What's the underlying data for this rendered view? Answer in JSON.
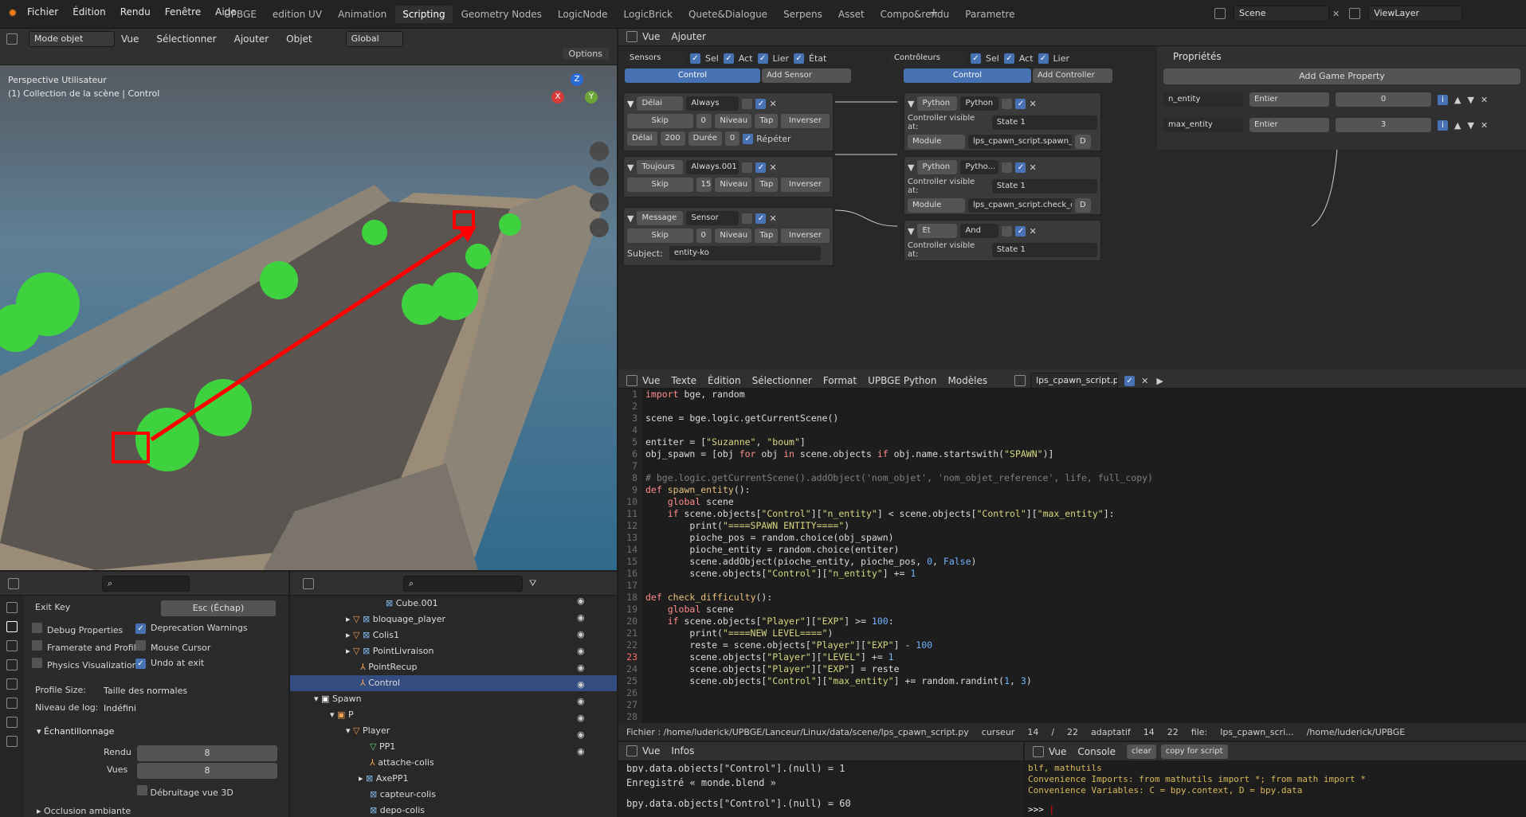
{
  "menu": [
    "Fichier",
    "Édition",
    "Rendu",
    "Fenêtre",
    "Aide"
  ],
  "workspaces": [
    "UPBGE",
    "edition UV",
    "Animation",
    "Scripting",
    "Geometry Nodes",
    "LogicNode",
    "LogicBrick",
    "Quete&Dialogue",
    "Serpens",
    "Asset",
    "Compo&rendu",
    "Parametre"
  ],
  "active_workspace": "Scripting",
  "scene": {
    "name": "Scene",
    "view_layer": "ViewLayer"
  },
  "viewport": {
    "mode": "Mode objet",
    "menus": [
      "Vue",
      "Sélectionner",
      "Ajouter",
      "Objet"
    ],
    "transform": "Global",
    "options": "Options",
    "overlay_title": "Perspective Utilisateur",
    "overlay_sub": "(1) Collection de la scène | Control",
    "gizmo": {
      "x": "X",
      "y": "Y",
      "z": "Z"
    }
  },
  "logic": {
    "menus": [
      "Vue",
      "Ajouter"
    ],
    "sensors_header": {
      "title": "Sensors",
      "sel": "Sel",
      "act": "Act",
      "lier": "Lier",
      "etat": "État",
      "control": "Control",
      "add": "Add Sensor"
    },
    "controllers_header": {
      "title": "Contrôleurs",
      "sel": "Sel",
      "act": "Act",
      "lier": "Lier",
      "control": "Control",
      "add": "Add Controller"
    },
    "sensors": [
      {
        "type": "Délai",
        "name": "Always",
        "skip_label": "Skip",
        "skip": "0",
        "niveau": "Niveau",
        "tap": "Tap",
        "inverser": "Inverser",
        "extra": {
          "delai_label": "Délai",
          "delai": "200",
          "duree_label": "Durée",
          "duree": "0",
          "repeter": "Répéter"
        }
      },
      {
        "type": "Toujours",
        "name": "Always.001",
        "skip_label": "Skip",
        "skip": "15",
        "niveau": "Niveau",
        "tap": "Tap",
        "inverser": "Inverser"
      },
      {
        "type": "Message",
        "name": "Sensor",
        "skip_label": "Skip",
        "skip": "0",
        "niveau": "Niveau",
        "tap": "Tap",
        "inverser": "Inverser",
        "subject_label": "Subject:",
        "subject": "entity-ko"
      }
    ],
    "controllers": [
      {
        "type": "Python",
        "name": "Python",
        "visible_label": "Controller visible at:",
        "state": "State 1",
        "mode": "Module",
        "script": "lps_cpawn_script.spawn_...",
        "d": "D"
      },
      {
        "type": "Python",
        "name": "Pytho...",
        "visible_label": "Controller visible at:",
        "state": "State 1",
        "mode": "Module",
        "script": "lps_cpawn_script.check_d...",
        "d": "D"
      },
      {
        "type": "Et",
        "name": "And",
        "visible_label": "Controller visible at:",
        "state": "State 1"
      }
    ]
  },
  "properties": {
    "title": "Propriétés",
    "add": "Add Game Property",
    "items": [
      {
        "name": "n_entity",
        "type": "Entier",
        "value": "0"
      },
      {
        "name": "max_entity",
        "type": "Entier",
        "value": "3"
      }
    ]
  },
  "text_editor": {
    "menus": [
      "Vue",
      "Texte",
      "Édition",
      "Sélectionner",
      "Format",
      "UPBGE Python",
      "Modèles"
    ],
    "filename": "lps_cpawn_script.py",
    "line_numbers": [
      "1",
      "2",
      "3",
      "4",
      "5",
      "6",
      "7",
      "8",
      "9",
      "10",
      "11",
      "12",
      "13",
      "14",
      "15",
      "16",
      "17",
      "18",
      "19",
      "20",
      "21",
      "22",
      "23",
      "24",
      "25",
      "26",
      "27",
      "28"
    ],
    "status": {
      "file": "Fichier : /home/luderick/UPBGE/Lanceur/Linux/data/scene/lps_cpawn_script.py",
      "cursor": "curseur",
      "c1": "14",
      "slash": "/",
      "c2": "22",
      "mode": "adaptatif",
      "c3": "14",
      "c4": "22",
      "file2": "file:",
      "file2name": "lps_cpawn_scri...",
      "path2": "/home/luderick/UPBGE"
    }
  },
  "info_log": {
    "menus": [
      "Vue",
      "Infos"
    ],
    "lines": [
      "bpy.data.objects[\"Control\"].(null) = 1",
      "Enregistré « monde.blend »",
      "bpy.data.objects[\"Control\"].(null) = 60"
    ]
  },
  "console": {
    "menus": [
      "Vue",
      "Console"
    ],
    "clear": "clear",
    "copy": "copy for script",
    "lines": [
      "blf, mathutils",
      "Convenience Imports:   from mathutils import *; from math import *",
      "Convenience Variables: C = bpy.context, D = bpy.data"
    ],
    "prompt": ">>> "
  },
  "render_props": {
    "exit_key_label": "Exit Key",
    "exit_key": "Esc (Échap)",
    "checks": [
      {
        "label": "Debug Properties",
        "on": false
      },
      {
        "label": "Deprecation Warnings",
        "on": true
      },
      {
        "label": "Framerate and Profile",
        "on": false
      },
      {
        "label": "Mouse Cursor",
        "on": false
      },
      {
        "label": "Physics Visualization",
        "on": false
      },
      {
        "label": "Undo at exit",
        "on": true
      }
    ],
    "profile_label": "Profile Size:",
    "profile": "Taille des normales",
    "log_label": "Niveau de log:",
    "log": "Indéfini",
    "sampling": "Échantillonnage",
    "rendu_label": "Rendu",
    "rendu": "8",
    "vues_label": "Vues",
    "vues": "8",
    "debug3d": "Débruitage vue 3D",
    "occlusion": "Occlusion ambiante"
  },
  "outliner": {
    "items": [
      "Cube.001",
      "bloquage_player",
      "Colis1",
      "PointLivraison",
      "PointRecup",
      "Control",
      "Spawn",
      "P",
      "Player",
      "PP1",
      "attache-colis",
      "AxePP1",
      "capteur-colis",
      "depo-colis"
    ]
  }
}
